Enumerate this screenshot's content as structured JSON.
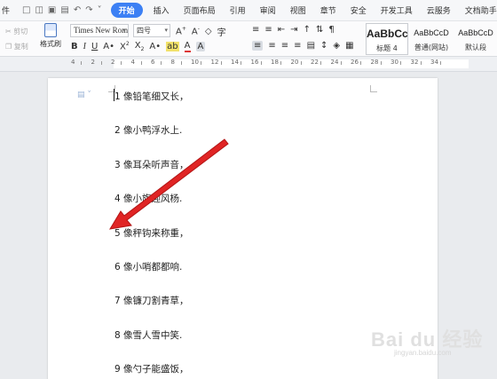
{
  "menubar": {
    "file_label": "件",
    "tabs": [
      "开始",
      "插入",
      "页面布局",
      "引用",
      "审阅",
      "视图",
      "章节",
      "安全",
      "开发工具",
      "云服务",
      "文档助手"
    ]
  },
  "ribbon": {
    "cut_label": "剪切",
    "copy_label": "复制",
    "format_painter_label": "格式刷",
    "font_name": "Times New Roma",
    "font_size": "四号",
    "styles": [
      {
        "preview": "AaBbCc",
        "name": "标题 4"
      },
      {
        "preview": "AaBbCcD",
        "name": "普通(网站)"
      },
      {
        "preview": "AaBbCcD",
        "name": "默认段"
      }
    ]
  },
  "ruler": {
    "labels": [
      "4",
      "2",
      "2",
      "4",
      "6",
      "8",
      "10",
      "12",
      "14",
      "16",
      "18",
      "20",
      "22",
      "24",
      "26",
      "28",
      "30",
      "32",
      "34"
    ]
  },
  "document": {
    "lines": [
      "1 像铅笔细又长，",
      "2 像小鸭浮水上.",
      "3 像耳朵听声音，",
      "4 像小旗迎风杨.",
      "5 像秤钩来称重，",
      "6 像小哨都都响.",
      "7 像镰刀割青草，",
      "8 像雪人雪中笑.",
      "9 像勺子能盛饭，"
    ]
  },
  "watermark": {
    "text": "Bai du 经验",
    "url": "jingyan.baidu.com"
  },
  "colors": {
    "accent": "#3c80f4",
    "arrow": "#e02424"
  }
}
